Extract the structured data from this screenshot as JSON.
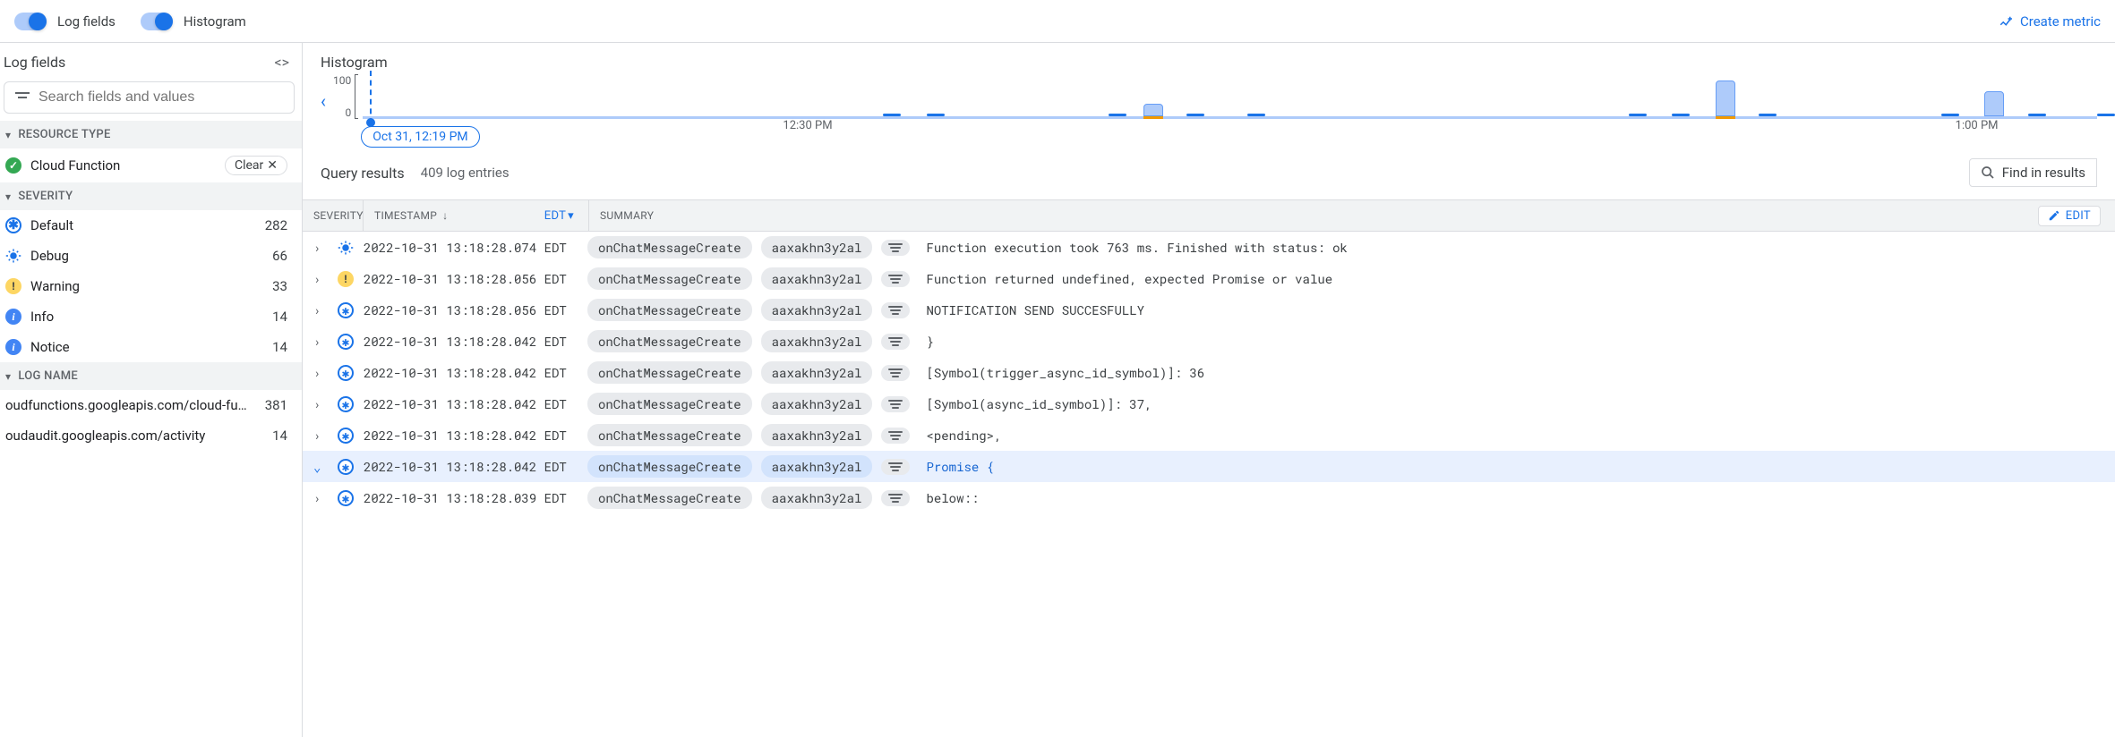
{
  "toolbar": {
    "toggle_log_fields": "Log fields",
    "toggle_histogram": "Histogram",
    "create_metric": "Create metric"
  },
  "sidebar": {
    "title": "Log fields",
    "search_placeholder": "Search fields and values",
    "sections": {
      "resource_type": {
        "label": "RESOURCE TYPE",
        "items": [
          {
            "label": "Cloud Function",
            "clear": "Clear"
          }
        ]
      },
      "severity": {
        "label": "SEVERITY",
        "items": [
          {
            "label": "Default",
            "count": "282",
            "icon": "default"
          },
          {
            "label": "Debug",
            "count": "66",
            "icon": "debug"
          },
          {
            "label": "Warning",
            "count": "33",
            "icon": "warning"
          },
          {
            "label": "Info",
            "count": "14",
            "icon": "info"
          },
          {
            "label": "Notice",
            "count": "14",
            "icon": "notice"
          }
        ]
      },
      "log_name": {
        "label": "LOG NAME",
        "items": [
          {
            "label": "oudfunctions.googleapis.com/cloud-fu…",
            "count": "381"
          },
          {
            "label": "oudaudit.googleapis.com/activity",
            "count": "14"
          }
        ]
      }
    }
  },
  "histogram": {
    "title": "Histogram",
    "y_max": "100",
    "y_min": "0",
    "marker_label": "Oct 31, 12:19 PM",
    "ticks": [
      "12:30 PM",
      "1:00 PM"
    ]
  },
  "results": {
    "title": "Query results",
    "count": "409 log entries",
    "find": "Find in results",
    "columns": {
      "severity": "SEVERITY",
      "timestamp": "TIMESTAMP",
      "timezone": "EDT",
      "summary": "SUMMARY",
      "edit": "EDIT"
    },
    "rows": [
      {
        "sev": "debug",
        "ts": "2022-10-31 13:18:28.074 EDT",
        "fn": "onChatMessageCreate",
        "id": "aaxakhn3y2al",
        "msg": "Function execution took 763 ms. Finished with status: ok"
      },
      {
        "sev": "warning",
        "ts": "2022-10-31 13:18:28.056 EDT",
        "fn": "onChatMessageCreate",
        "id": "aaxakhn3y2al",
        "msg": "Function returned undefined, expected Promise or value"
      },
      {
        "sev": "default",
        "ts": "2022-10-31 13:18:28.056 EDT",
        "fn": "onChatMessageCreate",
        "id": "aaxakhn3y2al",
        "msg": "NOTIFICATION SEND SUCCESFULLY"
      },
      {
        "sev": "default",
        "ts": "2022-10-31 13:18:28.042 EDT",
        "fn": "onChatMessageCreate",
        "id": "aaxakhn3y2al",
        "msg": "}"
      },
      {
        "sev": "default",
        "ts": "2022-10-31 13:18:28.042 EDT",
        "fn": "onChatMessageCreate",
        "id": "aaxakhn3y2al",
        "msg": "  [Symbol(trigger_async_id_symbol)]: 36"
      },
      {
        "sev": "default",
        "ts": "2022-10-31 13:18:28.042 EDT",
        "fn": "onChatMessageCreate",
        "id": "aaxakhn3y2al",
        "msg": "  [Symbol(async_id_symbol)]: 37,"
      },
      {
        "sev": "default",
        "ts": "2022-10-31 13:18:28.042 EDT",
        "fn": "onChatMessageCreate",
        "id": "aaxakhn3y2al",
        "msg": "  <pending>,"
      },
      {
        "sev": "default",
        "ts": "2022-10-31 13:18:28.042 EDT",
        "fn": "onChatMessageCreate",
        "id": "aaxakhn3y2al",
        "msg": "Promise {",
        "selected": true
      },
      {
        "sev": "default",
        "ts": "2022-10-31 13:18:28.039 EDT",
        "fn": "onChatMessageCreate",
        "id": "aaxakhn3y2al",
        "msg": "below::"
      }
    ]
  },
  "chart_data": {
    "type": "bar",
    "title": "Histogram",
    "ylabel": "",
    "ylim": [
      0,
      100
    ],
    "x_range": [
      "Oct 31 12:19 PM",
      "Oct 31 1:05 PM"
    ],
    "marker": "Oct 31, 12:19 PM",
    "ticks": [
      "12:30 PM",
      "1:00 PM"
    ],
    "bars": [
      {
        "x_pct": 30,
        "height": 3
      },
      {
        "x_pct": 32.5,
        "height": 3
      },
      {
        "x_pct": 43,
        "height": 3
      },
      {
        "x_pct": 45,
        "height": 14,
        "orange": true
      },
      {
        "x_pct": 47.5,
        "height": 3
      },
      {
        "x_pct": 51,
        "height": 3
      },
      {
        "x_pct": 73,
        "height": 3
      },
      {
        "x_pct": 75.5,
        "height": 3
      },
      {
        "x_pct": 78,
        "height": 40,
        "orange": true
      },
      {
        "x_pct": 80.5,
        "height": 3
      },
      {
        "x_pct": 91,
        "height": 3
      },
      {
        "x_pct": 93.5,
        "height": 28
      },
      {
        "x_pct": 96,
        "height": 3
      },
      {
        "x_pct": 100,
        "height": 3
      }
    ]
  }
}
